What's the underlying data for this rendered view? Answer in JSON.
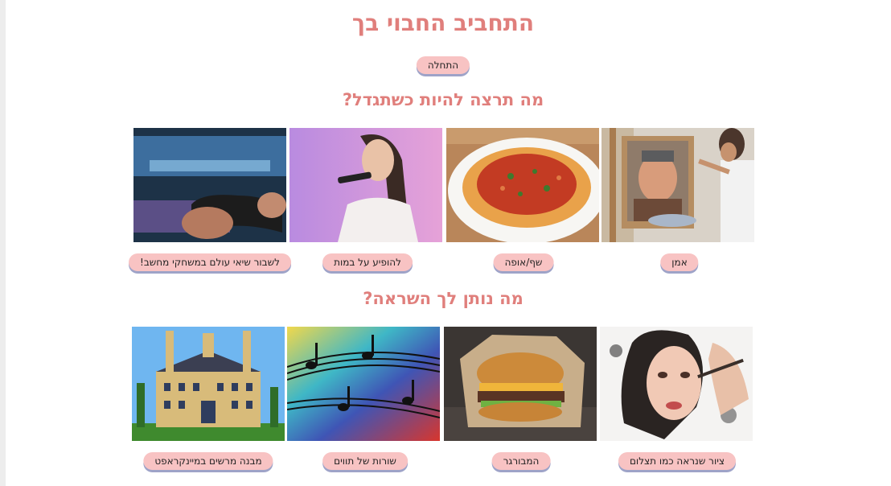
{
  "page": {
    "title": "התחביב החבוי בך",
    "start_button": "התחלה"
  },
  "section_grow_up": {
    "heading": "מה תרצה להיות כשתגדל?",
    "options": [
      {
        "label": "אמן",
        "image": "artist-painting-portrait"
      },
      {
        "label": "שף/אופה",
        "image": "pasta-plate"
      },
      {
        "label": "להופיע על במות",
        "image": "singer-on-stage"
      },
      {
        "label": "לשבור שיאי עולם במשחקי מחשב!",
        "image": "gamer-controller"
      }
    ]
  },
  "section_inspiration": {
    "heading": "מה נותן לך השראה?",
    "options": [
      {
        "label": "ציור שנראה כמו תצלום",
        "image": "realistic-portrait-drawing"
      },
      {
        "label": "המבורגר",
        "image": "hamburger"
      },
      {
        "label": "שורות של תווים",
        "image": "colorful-music-notes"
      },
      {
        "label": "מבנה מרשים במיינקראפט",
        "image": "minecraft-mansion"
      }
    ]
  },
  "colors": {
    "heading": "#e07f7c",
    "button_bg": "#f8c3c3",
    "button_shadow": "#9ea3c8"
  }
}
